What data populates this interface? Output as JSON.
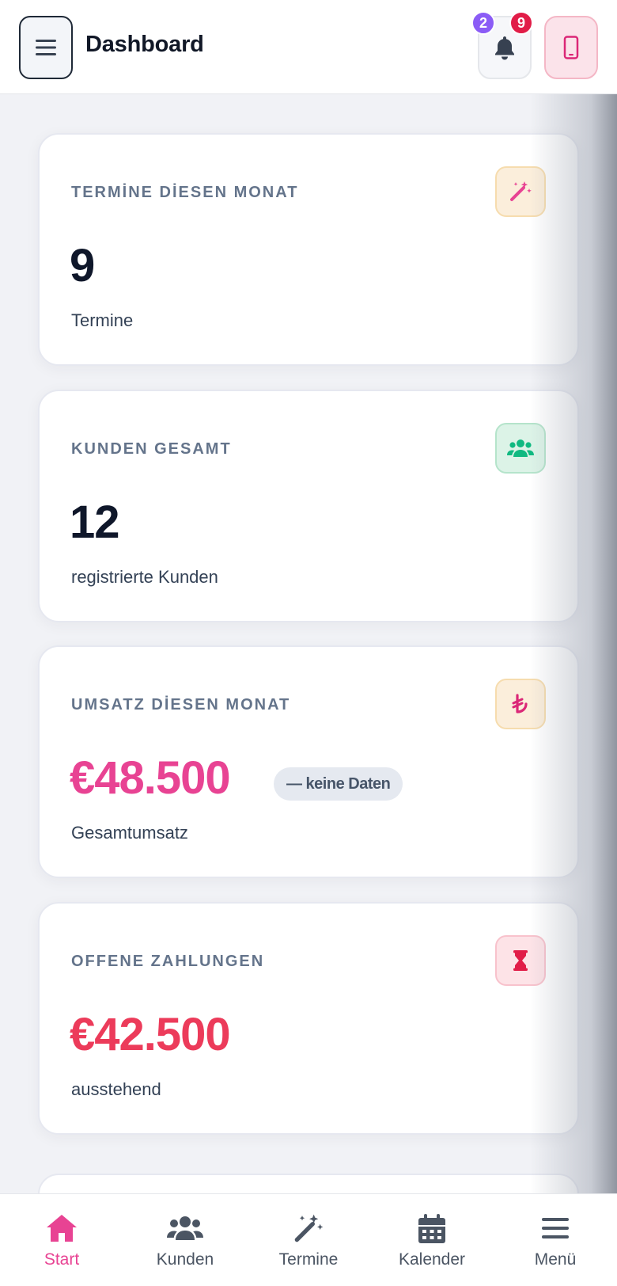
{
  "header": {
    "title": "Dashboard",
    "notification_badges": [
      "2",
      "9"
    ]
  },
  "cards": [
    {
      "label": "TERMİNE DİESEN MONAT",
      "value": "9",
      "sub": "Termine",
      "icon": "magic-wand-icon"
    },
    {
      "label": "KUNDEN GESAMT",
      "value": "12",
      "sub": "registrierte Kunden",
      "icon": "users-icon"
    },
    {
      "label": "UMSATZ DİESEN MONAT",
      "value": "€48.500",
      "pill": "— keine Daten",
      "sub": "Gesamtumsatz",
      "icon": "lira-icon"
    },
    {
      "label": "OFFENE ZAHLUNGEN",
      "value": "€42.500",
      "sub": "ausstehend",
      "icon": "hourglass-icon"
    }
  ],
  "nav": {
    "items": [
      {
        "label": "Start",
        "icon": "home-icon",
        "active": true
      },
      {
        "label": "Kunden",
        "icon": "users-icon"
      },
      {
        "label": "Termine",
        "icon": "magic-wand-icon"
      },
      {
        "label": "Kalender",
        "icon": "calendar-icon"
      },
      {
        "label": "Menü",
        "icon": "menu-icon"
      }
    ]
  },
  "colors": {
    "accent_pink": "#e84393",
    "accent_red": "#ec3b5a",
    "badge_purple": "#8b5cf6",
    "badge_red": "#e11d48",
    "green_icon": "#10b981"
  }
}
